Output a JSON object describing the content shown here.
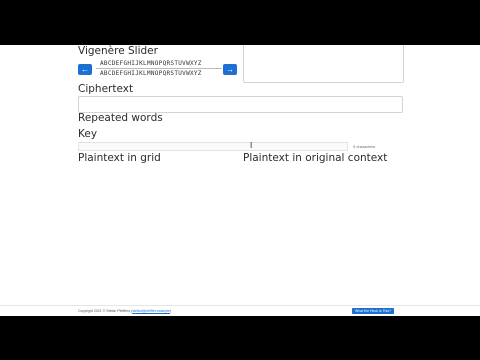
{
  "sections": {
    "vigenere_slider": "Vigenère Slider",
    "ciphertext": "Ciphertext",
    "repeated_words": "Repeated words",
    "key": "Key",
    "plaintext_grid": "Plaintext in grid",
    "plaintext_context": "Plaintext in original context"
  },
  "slider": {
    "left_button": "←",
    "right_button": "→",
    "top_alphabet": "ABCDEFGHIJKLMNOPQRSTUVWXYZ",
    "bottom_alphabet": "ABCDEFGHIJKLMNOPQRSTUVWXYZ"
  },
  "key": {
    "char_count": "0 characters"
  },
  "footer": {
    "copyright": "Copyright 2021 © Stefan Pfeiffers (",
    "link": "stefan@pfeiffer.example",
    "copyright_end": ")",
    "button": "What the Heck is This?"
  },
  "colors": {
    "accent": "#1d6fd1",
    "background": "#ffffff",
    "letterbox": "#000000"
  }
}
